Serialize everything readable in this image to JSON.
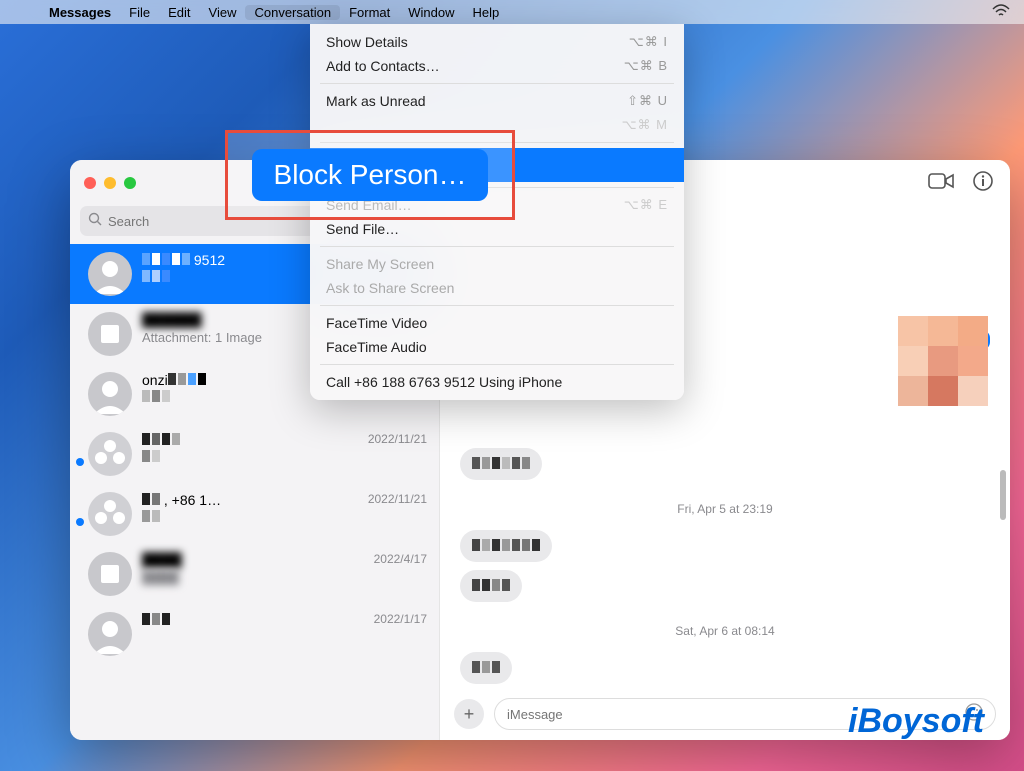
{
  "menubar": {
    "items": [
      "Messages",
      "File",
      "Edit",
      "View",
      "Conversation",
      "Format",
      "Window",
      "Help"
    ],
    "open_index": 4
  },
  "dropdown": {
    "highlight_label": "Block Person…",
    "items": [
      {
        "label": "Show Details",
        "shortcut": "⌥⌘ I",
        "disabled": false
      },
      {
        "label": "Add to Contacts…",
        "shortcut": "⌥⌘ B",
        "disabled": false
      },
      {
        "sep": true
      },
      {
        "label": "Mark as Unread",
        "shortcut": "⇧⌘ U",
        "disabled": false
      },
      {
        "label": "",
        "shortcut": "⌥⌘ M",
        "disabled": true
      },
      {
        "sep": true
      },
      {
        "highlight": true
      },
      {
        "sep": true
      },
      {
        "label": "Send Email…",
        "shortcut": "⌥⌘ E",
        "disabled": true
      },
      {
        "label": "Send File…",
        "shortcut": "",
        "disabled": false
      },
      {
        "sep": true
      },
      {
        "label": "Share My Screen",
        "shortcut": "",
        "disabled": true
      },
      {
        "label": "Ask to Share Screen",
        "shortcut": "",
        "disabled": true
      },
      {
        "sep": true
      },
      {
        "label": "FaceTime Video",
        "shortcut": "",
        "disabled": false
      },
      {
        "label": "FaceTime Audio",
        "shortcut": "",
        "disabled": false
      },
      {
        "sep": true
      },
      {
        "label": "Call +86 188 6763 9512 Using iPhone",
        "shortcut": "",
        "disabled": false
      }
    ]
  },
  "sidebar": {
    "search_placeholder": "Search",
    "conversations": [
      {
        "name": "9512",
        "date": "",
        "preview": "",
        "selected": true,
        "unread": false,
        "group": false
      },
      {
        "name": "",
        "date": "",
        "preview": "Attachment: 1 Image",
        "selected": false,
        "unread": false,
        "group": false
      },
      {
        "name": "onzi",
        "date": "",
        "preview": "",
        "selected": false,
        "unread": false,
        "group": false
      },
      {
        "name": "",
        "date": "2022/11/21",
        "preview": "",
        "selected": false,
        "unread": true,
        "group": true
      },
      {
        "name": "+86 1…",
        "date": "2022/11/21",
        "preview": "",
        "selected": false,
        "unread": true,
        "group": true
      },
      {
        "name": "",
        "date": "2022/4/17",
        "preview": "",
        "selected": false,
        "unread": false,
        "group": false
      },
      {
        "name": "",
        "date": "2022/1/17",
        "preview": "",
        "selected": false,
        "unread": false,
        "group": false
      }
    ]
  },
  "chat": {
    "timestamps": [
      "Fri, Apr 5 at 23:19",
      "Sat, Apr 6 at 08:14"
    ],
    "input_placeholder": "iMessage"
  },
  "watermark": "iBoysoft"
}
